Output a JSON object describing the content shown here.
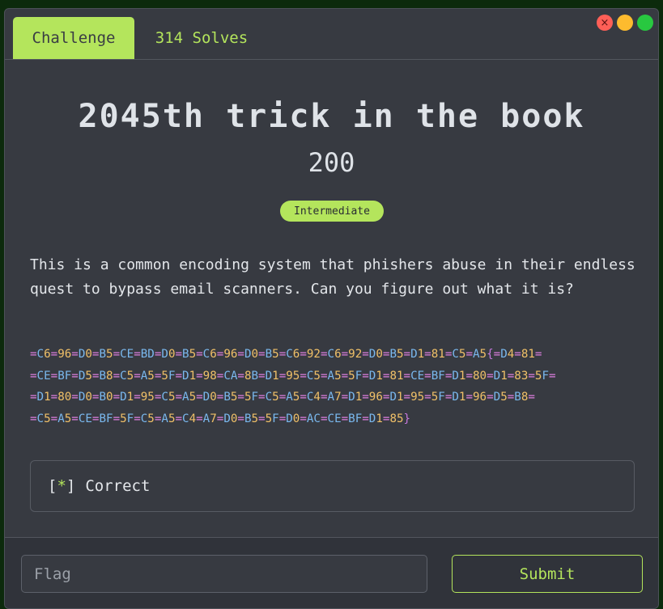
{
  "window": {
    "controls": {
      "close_symbol": "×"
    }
  },
  "tabs": [
    {
      "label": "Challenge",
      "active": true
    },
    {
      "label": "314 Solves",
      "active": false
    }
  ],
  "challenge": {
    "title": "2045th trick in the book",
    "points": "200",
    "difficulty": "Intermediate",
    "description": "This is a common encoding system that phishers abuse in their endless quest to bypass email scanners. Can you figure out what it is?",
    "encoded_lines": [
      "=C6=96=D0=B5=CE=BD=D0=B5=C6=96=D0=B5=C6=92=C6=92=D0=B5=D1=81=C5=A5{=D4=81=",
      "=CE=BF=D5=B8=C5=A5=5F=D1=98=CA=8B=D1=95=C5=A5=5F=D1=81=CE=BF=D1=80=D1=83=5F=",
      "=D1=80=D0=B0=D1=95=C5=A5=D0=B5=5F=C5=A5=C4=A7=D1=96=D1=95=5F=D1=96=D5=B8=",
      "=C5=A5=CE=BF=5F=C5=A5=C4=A7=D0=B5=5F=D0=AC=CE=BF=D1=85}"
    ]
  },
  "result": {
    "bracket_open": "[",
    "star": "*",
    "bracket_close": "]",
    "text": "Correct"
  },
  "footer": {
    "flag_placeholder": "Flag",
    "submit_label": "Submit"
  },
  "colors": {
    "accent": "#b4e55c",
    "panel_bg": "#373a41",
    "encoded_equals": "#dd7ee0",
    "encoded_hex": "#7ab8ee",
    "encoded_digits": "#f0c068"
  }
}
